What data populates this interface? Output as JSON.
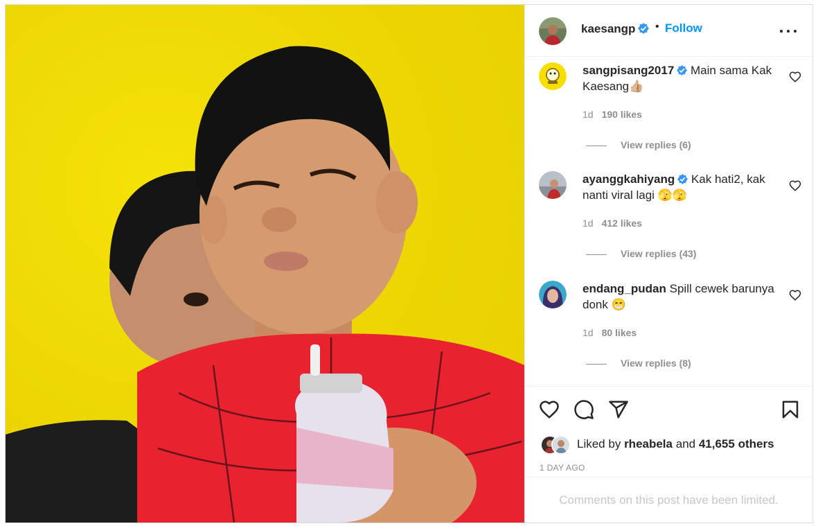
{
  "post": {
    "author": "kaesangp",
    "separator": "•",
    "follow_label": "Follow",
    "more_icon": "more-horizontal-icon"
  },
  "comments": [
    {
      "username": "sangpisang2017",
      "verified": true,
      "text": "Main sama Kak Kaesang👍🏼",
      "age": "1d",
      "likes": "190 likes",
      "replies": "View replies (6)"
    },
    {
      "username": "ayanggkahiyang",
      "verified": true,
      "text": "Kak hati2, kak nanti viral lagi 🫣🫣",
      "age": "1d",
      "likes": "412 likes",
      "replies": "View replies (43)"
    },
    {
      "username": "endang_pudan",
      "verified": false,
      "text": "Spill cewek barunya donk 😁",
      "age": "1d",
      "likes": "80 likes",
      "replies": "View replies (8)"
    }
  ],
  "actions": {
    "like_icon": "heart-icon",
    "comment_icon": "comment-icon",
    "share_icon": "send-icon",
    "save_icon": "bookmark-icon"
  },
  "likes_summary": {
    "prefix": "Liked by",
    "user": "rheabela",
    "middle": "and",
    "others": "41,655 others"
  },
  "timestamp": "1 DAY AGO",
  "comments_limited": "Comments on this post have been limited.",
  "colors": {
    "accent": "#0095f6",
    "verified": "#3897f0",
    "photo_bg": "#f2dd05",
    "shirt": "#e8222e"
  }
}
